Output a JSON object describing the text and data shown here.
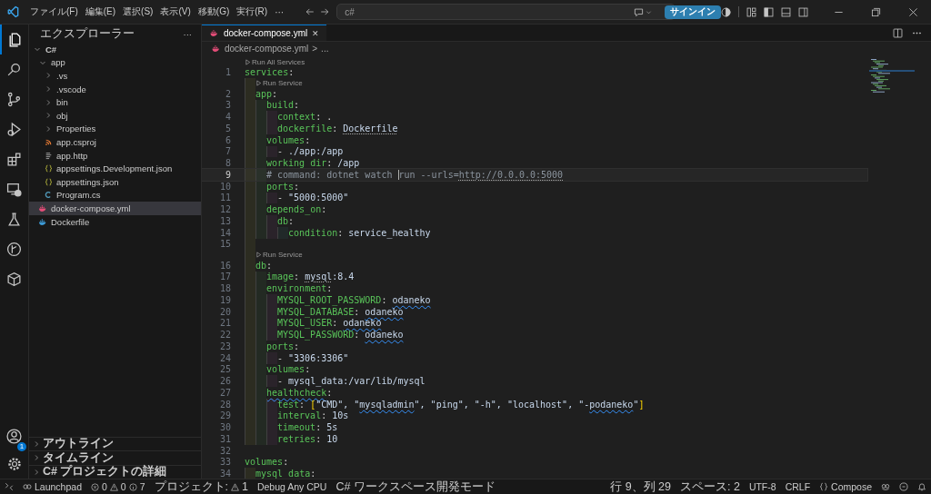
{
  "title_bar": {
    "menu": [
      "ファイル(F)",
      "編集(E)",
      "選択(S)",
      "表示(V)",
      "移動(G)",
      "実行(R)",
      "···"
    ],
    "search": {
      "value": "c#"
    },
    "sign_in": "サインイン"
  },
  "activity_bar": {
    "items": [
      {
        "selected": true
      },
      {
        "selected": false
      },
      {
        "selected": false
      },
      {
        "selected": false
      },
      {
        "selected": false
      },
      {
        "selected": false
      },
      {
        "selected": false
      },
      {
        "selected": false
      },
      {
        "selected": false
      }
    ],
    "account_badge": "1"
  },
  "sidebar": {
    "title": "エクスプローラー",
    "more": "···",
    "tree": [
      {
        "label": "C#",
        "kind": "root",
        "expanded": true,
        "selected": false,
        "children": [
          {
            "label": "app",
            "kind": "folder",
            "expanded": true,
            "selected": false,
            "children": [
              {
                "label": ".vs",
                "kind": "folder",
                "expanded": false,
                "selected": false
              },
              {
                "label": ".vscode",
                "kind": "folder",
                "expanded": false,
                "selected": false
              },
              {
                "label": "bin",
                "kind": "folder",
                "expanded": false,
                "selected": false
              },
              {
                "label": "obj",
                "kind": "folder",
                "expanded": false,
                "selected": false
              },
              {
                "label": "Properties",
                "kind": "folder",
                "expanded": false,
                "selected": false
              },
              {
                "label": "app.csproj",
                "kind": "project",
                "selected": false
              },
              {
                "label": "app.http",
                "kind": "http",
                "selected": false
              },
              {
                "label": "appsettings.Development.json",
                "kind": "json",
                "selected": false
              },
              {
                "label": "appsettings.json",
                "kind": "json",
                "selected": false
              },
              {
                "label": "Program.cs",
                "kind": "csharp",
                "selected": false
              }
            ]
          },
          {
            "label": "docker-compose.yml",
            "kind": "compose",
            "selected": true
          },
          {
            "label": "Dockerfile",
            "kind": "docker",
            "selected": false
          }
        ]
      }
    ],
    "panes": [
      {
        "label": "アウトライン",
        "expanded": false
      },
      {
        "label": "タイムライン",
        "expanded": false
      },
      {
        "label": "C# プロジェクトの詳細",
        "expanded": false
      }
    ]
  },
  "editor": {
    "tabs": [
      {
        "label": "docker-compose.yml",
        "selected": true,
        "close": "✕"
      }
    ],
    "breadcrumb": {
      "file": "docker-compose.yml",
      "separator": ">",
      "rest": "..."
    },
    "lines": [
      {
        "number": "1",
        "lens": "Run All Services",
        "tokens": [
          {
            "text": "services",
            "kind": "key"
          },
          {
            "text": ":",
            "kind": "punct"
          }
        ],
        "children": [
          {
            "number": "2",
            "lens": "Run Service",
            "tokens": [
              {
                "text": "app",
                "kind": "key"
              },
              {
                "text": ":",
                "kind": "punct"
              }
            ],
            "children": [
              {
                "number": "3",
                "tokens": [
                  {
                    "text": "build",
                    "kind": "key"
                  },
                  {
                    "text": ":",
                    "kind": "punct"
                  }
                ],
                "children": [
                  {
                    "number": "4",
                    "tokens": [
                      {
                        "text": "context",
                        "kind": "key"
                      },
                      {
                        "text": ": .",
                        "kind": "punct"
                      }
                    ]
                  },
                  {
                    "number": "5",
                    "tokens": [
                      {
                        "text": "dockerfile",
                        "kind": "key"
                      },
                      {
                        "text": ": ",
                        "kind": "punct"
                      },
                      {
                        "text": "Dockerfile",
                        "kind": "value",
                        "link": true
                      }
                    ]
                  }
                ]
              },
              {
                "number": "6",
                "tokens": [
                  {
                    "text": "volumes",
                    "kind": "key"
                  },
                  {
                    "text": ":",
                    "kind": "punct"
                  }
                ],
                "children": [
                  {
                    "number": "7",
                    "tokens": [
                      {
                        "text": "- ",
                        "kind": "punct"
                      },
                      {
                        "text": "./app:/app",
                        "kind": "value"
                      }
                    ]
                  }
                ]
              },
              {
                "number": "8",
                "tokens": [
                  {
                    "text": "working_dir",
                    "kind": "key"
                  },
                  {
                    "text": ": ",
                    "kind": "punct"
                  },
                  {
                    "text": "/app",
                    "kind": "value"
                  }
                ]
              },
              {
                "number": "9",
                "current": true,
                "tokens": [
                  {
                    "text": "# command: dotnet watch ",
                    "kind": "comment"
                  },
                  {
                    "text": "run --urls=",
                    "kind": "comment",
                    "cursor": true
                  },
                  {
                    "text": "http://0.0.0.0:5000",
                    "kind": "comment",
                    "link": true
                  }
                ]
              },
              {
                "number": "10",
                "tokens": [
                  {
                    "text": "ports",
                    "kind": "key"
                  },
                  {
                    "text": ":",
                    "kind": "punct"
                  }
                ],
                "children": [
                  {
                    "number": "11",
                    "tokens": [
                      {
                        "text": "- ",
                        "kind": "punct"
                      },
                      {
                        "text": "\"5000:5000\"",
                        "kind": "value"
                      }
                    ]
                  }
                ]
              },
              {
                "number": "12",
                "tokens": [
                  {
                    "text": "depends_on",
                    "kind": "key"
                  },
                  {
                    "text": ":",
                    "kind": "punct"
                  }
                ],
                "children": [
                  {
                    "number": "13",
                    "tokens": [
                      {
                        "text": "db",
                        "kind": "key"
                      },
                      {
                        "text": ":",
                        "kind": "punct"
                      }
                    ],
                    "children": [
                      {
                        "number": "14",
                        "tokens": [
                          {
                            "text": "condition",
                            "kind": "key"
                          },
                          {
                            "text": ": ",
                            "kind": "punct"
                          },
                          {
                            "text": "service_healthy",
                            "kind": "value"
                          }
                        ]
                      }
                    ]
                  }
                ]
              }
            ]
          },
          {
            "number": "15"
          },
          {
            "number": "16",
            "lens": "Run Service",
            "tokens": [
              {
                "text": "db",
                "kind": "key"
              },
              {
                "text": ":",
                "kind": "punct"
              }
            ],
            "children": [
              {
                "number": "17",
                "tokens": [
                  {
                    "text": "image",
                    "kind": "key"
                  },
                  {
                    "text": ": ",
                    "kind": "punct"
                  },
                  {
                    "text": "mysql",
                    "kind": "value",
                    "link": true
                  },
                  {
                    "text": ":8.4",
                    "kind": "value"
                  }
                ]
              },
              {
                "number": "18",
                "tokens": [
                  {
                    "text": "environment",
                    "kind": "key"
                  },
                  {
                    "text": ":",
                    "kind": "punct"
                  }
                ],
                "children": [
                  {
                    "number": "19",
                    "tokens": [
                      {
                        "text": "MYSQL_ROOT_PASSWORD",
                        "kind": "key"
                      },
                      {
                        "text": ": ",
                        "kind": "punct"
                      },
                      {
                        "text": "odaneko",
                        "kind": "value",
                        "squiggle": true
                      }
                    ]
                  },
                  {
                    "number": "20",
                    "tokens": [
                      {
                        "text": "MYSQL_DATABASE",
                        "kind": "key"
                      },
                      {
                        "text": ": ",
                        "kind": "punct"
                      },
                      {
                        "text": "odaneko",
                        "kind": "value",
                        "squiggle": true
                      }
                    ]
                  },
                  {
                    "number": "21",
                    "tokens": [
                      {
                        "text": "MYSQL_USER",
                        "kind": "key"
                      },
                      {
                        "text": ": ",
                        "kind": "punct"
                      },
                      {
                        "text": "odaneko",
                        "kind": "value",
                        "squiggle": true
                      }
                    ]
                  },
                  {
                    "number": "22",
                    "tokens": [
                      {
                        "text": "MYSQL_PASSWORD",
                        "kind": "key"
                      },
                      {
                        "text": ": ",
                        "kind": "punct"
                      },
                      {
                        "text": "odaneko",
                        "kind": "value",
                        "squiggle": true
                      }
                    ]
                  }
                ]
              },
              {
                "number": "23",
                "tokens": [
                  {
                    "text": "ports",
                    "kind": "key"
                  },
                  {
                    "text": ":",
                    "kind": "punct"
                  }
                ],
                "children": [
                  {
                    "number": "24",
                    "tokens": [
                      {
                        "text": "- ",
                        "kind": "punct"
                      },
                      {
                        "text": "\"3306:3306\"",
                        "kind": "value"
                      }
                    ]
                  }
                ]
              },
              {
                "number": "25",
                "tokens": [
                  {
                    "text": "volumes",
                    "kind": "key"
                  },
                  {
                    "text": ":",
                    "kind": "punct"
                  }
                ],
                "children": [
                  {
                    "number": "26",
                    "tokens": [
                      {
                        "text": "- ",
                        "kind": "punct"
                      },
                      {
                        "text": "mysql_data:/var/lib/mysql",
                        "kind": "value"
                      }
                    ]
                  }
                ]
              },
              {
                "number": "27",
                "tokens": [
                  {
                    "text": "healthcheck",
                    "kind": "key",
                    "squiggle": true
                  },
                  {
                    "text": ":",
                    "kind": "punct"
                  }
                ],
                "children": [
                  {
                    "number": "28",
                    "tokens": [
                      {
                        "text": "test",
                        "kind": "key"
                      },
                      {
                        "text": ": ",
                        "kind": "punct"
                      },
                      {
                        "text": "[",
                        "kind": "bracket"
                      },
                      {
                        "text": "\"CMD\", \"",
                        "kind": "value"
                      },
                      {
                        "text": "mysqladmin",
                        "kind": "value",
                        "squiggle": true
                      },
                      {
                        "text": "\", \"ping\", \"-h\", \"localhost\", \"-",
                        "kind": "value"
                      },
                      {
                        "text": "podaneko",
                        "kind": "value",
                        "squiggle": true
                      },
                      {
                        "text": "\"",
                        "kind": "value"
                      },
                      {
                        "text": "]",
                        "kind": "bracket"
                      }
                    ]
                  },
                  {
                    "number": "29",
                    "tokens": [
                      {
                        "text": "interval",
                        "kind": "key"
                      },
                      {
                        "text": ": ",
                        "kind": "punct"
                      },
                      {
                        "text": "10s",
                        "kind": "value"
                      }
                    ]
                  },
                  {
                    "number": "30",
                    "tokens": [
                      {
                        "text": "timeout",
                        "kind": "key"
                      },
                      {
                        "text": ": ",
                        "kind": "punct"
                      },
                      {
                        "text": "5s",
                        "kind": "value"
                      }
                    ]
                  },
                  {
                    "number": "31",
                    "tokens": [
                      {
                        "text": "retries",
                        "kind": "key"
                      },
                      {
                        "text": ": ",
                        "kind": "punct"
                      },
                      {
                        "text": "10",
                        "kind": "value"
                      }
                    ]
                  }
                ]
              }
            ]
          }
        ]
      },
      {
        "number": "32"
      },
      {
        "number": "33",
        "tokens": [
          {
            "text": "volumes",
            "kind": "key"
          },
          {
            "text": ":",
            "kind": "punct"
          }
        ],
        "children": [
          {
            "number": "34",
            "tokens": [
              {
                "text": "mysql_data",
                "kind": "key"
              },
              {
                "text": ":",
                "kind": "punct"
              }
            ]
          }
        ]
      }
    ]
  },
  "status_bar": {
    "launchpad": "Launchpad",
    "errors": "0",
    "warnings": "0",
    "infos": "7",
    "project_label": "プロジェクト:",
    "project_warnings": "1",
    "configuration": "Debug Any CPU",
    "workspace_mode": "C# ワークスペース開発モード",
    "position": "行 9、列 29",
    "indentation": "スペース: 2",
    "encoding": "UTF-8",
    "line_ending": "CRLF",
    "language": "Compose"
  }
}
